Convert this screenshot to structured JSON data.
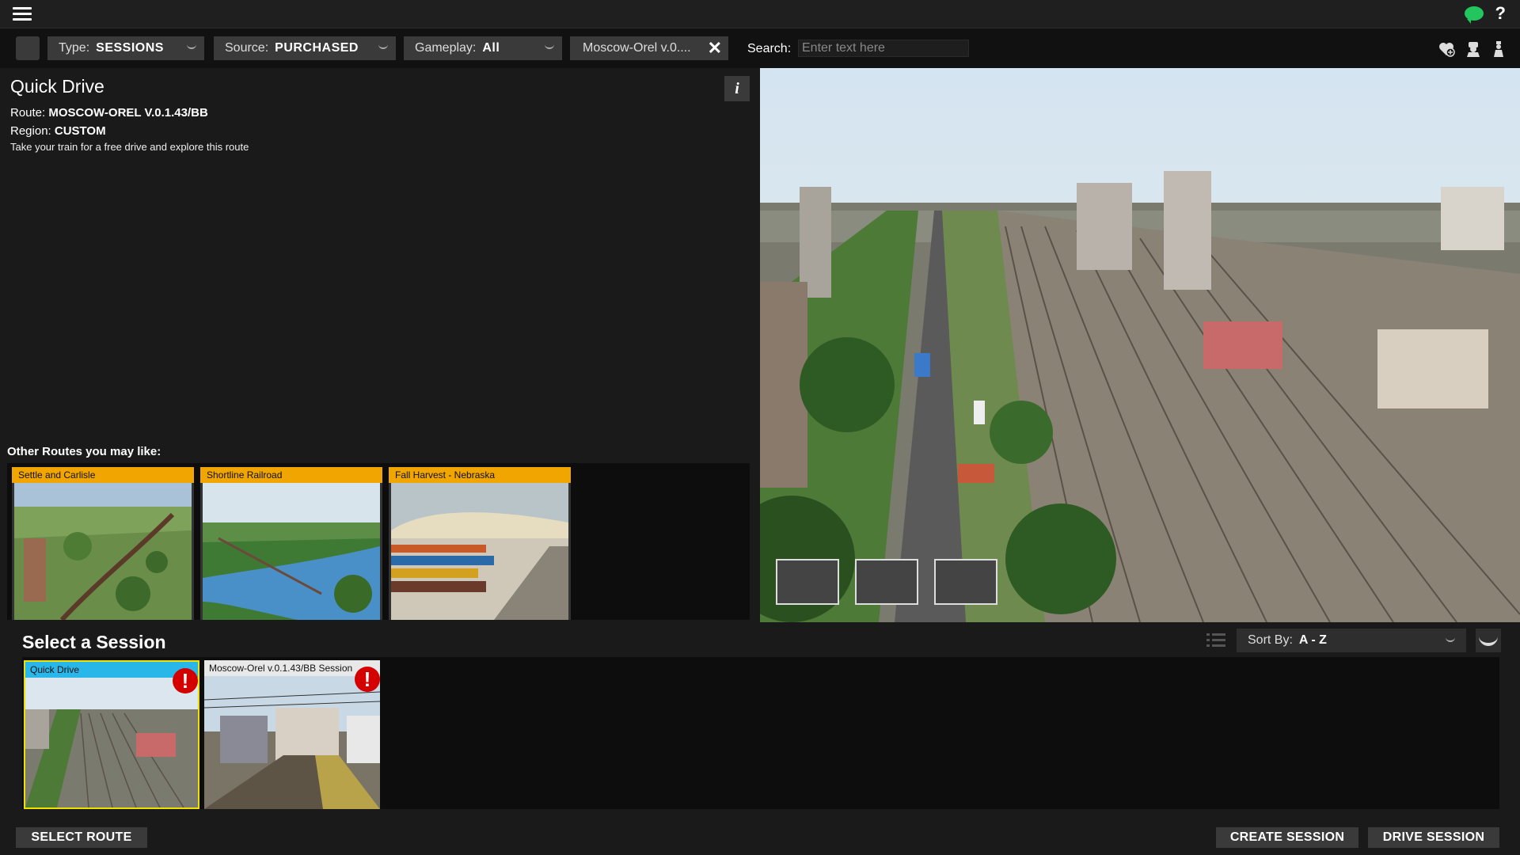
{
  "filters": {
    "type_label": "Type:",
    "type_value": "SESSIONS",
    "source_label": "Source:",
    "source_value": "PURCHASED",
    "gameplay_label": "Gameplay:",
    "gameplay_value": "All",
    "route_filter": "Moscow-Orel v.0....",
    "search_label": "Search:",
    "search_placeholder": "Enter text here"
  },
  "detail": {
    "title": "Quick Drive",
    "route_label": "Route:",
    "route_value": "MOSCOW-OREL V.0.1.43/BB",
    "region_label": "Region:",
    "region_value": "CUSTOM",
    "description": "Take your train for a free drive and explore this route",
    "info_glyph": "i"
  },
  "other_routes": {
    "title": "Other Routes you may like:",
    "items": [
      {
        "label": "Settle and Carlisle"
      },
      {
        "label": "Shortline Railroad"
      },
      {
        "label": "Fall Harvest - Nebraska"
      }
    ]
  },
  "sessions": {
    "title": "Select a Session",
    "sort_label": "Sort By:",
    "sort_value": "A - Z",
    "items": [
      {
        "label": "Quick Drive",
        "selected": true
      },
      {
        "label": "Moscow-Orel v.0.1.43/BB Session",
        "selected": false
      }
    ]
  },
  "footer": {
    "select_route": "SELECT ROUTE",
    "create_session": "CREATE SESSION",
    "drive_session": "DRIVE SESSION"
  },
  "icons": {
    "menu": "hamburger-menu-icon",
    "chat": "chat-bubble-icon",
    "help": "help-icon",
    "warning": "warning-icon"
  },
  "colors": {
    "accent_orange": "#f0a500",
    "accent_blue": "#29b6e8",
    "selected_border": "#f0e000",
    "warning_red": "#d40000",
    "chat_green": "#22c55e"
  }
}
